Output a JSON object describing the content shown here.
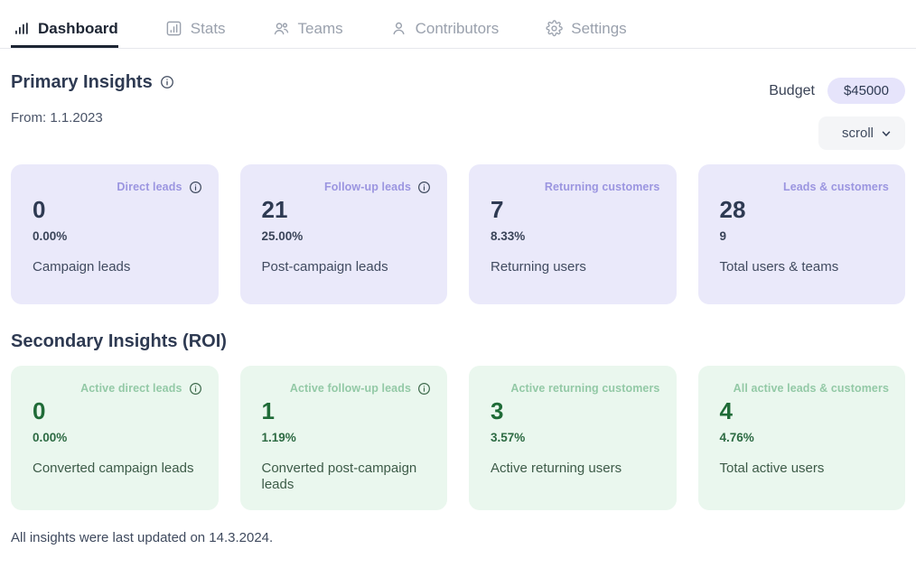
{
  "tabs": [
    {
      "label": "Dashboard",
      "icon": "bar-chart-icon",
      "active": true
    },
    {
      "label": "Stats",
      "icon": "chart-square-icon",
      "active": false
    },
    {
      "label": "Teams",
      "icon": "users-icon",
      "active": false
    },
    {
      "label": "Contributors",
      "icon": "user-icon",
      "active": false
    },
    {
      "label": "Settings",
      "icon": "gear-icon",
      "active": false
    }
  ],
  "primary": {
    "title": "Primary Insights",
    "info_icon": "info-icon",
    "from_label": "From: 1.1.2023",
    "budget_label": "Budget",
    "budget_value": "$45000",
    "select_value": "scroll",
    "select_options": [
      "scroll"
    ],
    "cards": [
      {
        "label": "Direct leads",
        "has_info": true,
        "value": "0",
        "sub": "0.00%",
        "desc": "Campaign leads"
      },
      {
        "label": "Follow-up leads",
        "has_info": true,
        "value": "21",
        "sub": "25.00%",
        "desc": "Post-campaign leads"
      },
      {
        "label": "Returning customers",
        "has_info": false,
        "value": "7",
        "sub": "8.33%",
        "desc": "Returning users"
      },
      {
        "label": "Leads & customers",
        "has_info": false,
        "value": "28",
        "sub": "9",
        "desc": "Total users & teams"
      }
    ]
  },
  "secondary": {
    "title": "Secondary Insights (ROI)",
    "cards": [
      {
        "label": "Active direct leads",
        "has_info": true,
        "value": "0",
        "sub": "0.00%",
        "desc": "Converted campaign leads"
      },
      {
        "label": "Active follow-up leads",
        "has_info": true,
        "value": "1",
        "sub": "1.19%",
        "desc": "Converted post-campaign leads"
      },
      {
        "label": "Active returning customers",
        "has_info": false,
        "value": "3",
        "sub": "3.57%",
        "desc": "Active returning users"
      },
      {
        "label": "All active leads & customers",
        "has_info": false,
        "value": "4",
        "sub": "4.76%",
        "desc": "Total active users"
      }
    ]
  },
  "footer": {
    "note": "All insights were last updated on 14.3.2024."
  },
  "colors": {
    "primary_card_bg": "#eae9fa",
    "secondary_card_bg": "#eaf7ee",
    "primary_label": "#9b95e0",
    "secondary_label": "#93c9a6",
    "budget_pill_bg": "#e6e4fb",
    "text_dark": "#2e3a52",
    "tab_inactive": "#9aa1ad"
  }
}
